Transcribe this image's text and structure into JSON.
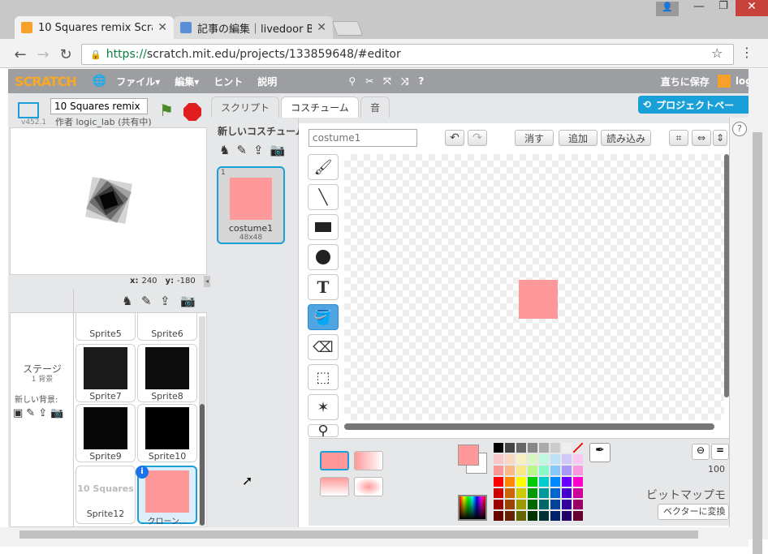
{
  "browser": {
    "tabs": [
      {
        "title": "10 Squares remix Scra"
      },
      {
        "title": "記事の編集｜livedoor B"
      }
    ],
    "url": "https://scratch.mit.edu/projects/133859648/#editor",
    "url_secure": "https://",
    "url_rest": "scratch.mit.edu/projects/133859648/#editor"
  },
  "menu": {
    "logo": "SCRATCH",
    "file": "ファイル▾",
    "edit": "編集▾",
    "hint": "ヒント",
    "about": "説明",
    "save_now": "直ちに保存",
    "user": "logic"
  },
  "project": {
    "title": "10 Squares remix",
    "version": "v452.1",
    "author": "作者 logic_lab (共有中)"
  },
  "stage_coords": {
    "x_label": "x:",
    "x": "240",
    "y_label": "y:",
    "y": "-180"
  },
  "tabs": {
    "scripts": "スクリプト",
    "costumes": "コスチューム",
    "sounds": "音",
    "project_page": "プロジェクトペー"
  },
  "new_costume": "新しいコスチューム:",
  "costume": {
    "index": "1",
    "name": "costume1",
    "size": "48x48"
  },
  "editor": {
    "name_placeholder": "costume1",
    "clear": "消す",
    "add": "追加",
    "import": "読み込み",
    "zoom": "100",
    "mode": "ビットマップモ",
    "convert": "ベクターに変換"
  },
  "stage_panel": {
    "label": "ステージ",
    "sub": "1 背景",
    "new_backdrop": "新しい背景:"
  },
  "sprites": [
    {
      "name": "Sprite5"
    },
    {
      "name": "Sprite6"
    },
    {
      "name": "Sprite7"
    },
    {
      "name": "Sprite8"
    },
    {
      "name": "Sprite9"
    },
    {
      "name": "Sprite10"
    },
    {
      "name": "Sprite12",
      "preview": "10 Squares"
    },
    {
      "name": "クローン..."
    }
  ],
  "colors": {
    "accent": "#1aa0d8",
    "costume": "#ff9999",
    "menubar": "#9c9ea2"
  }
}
